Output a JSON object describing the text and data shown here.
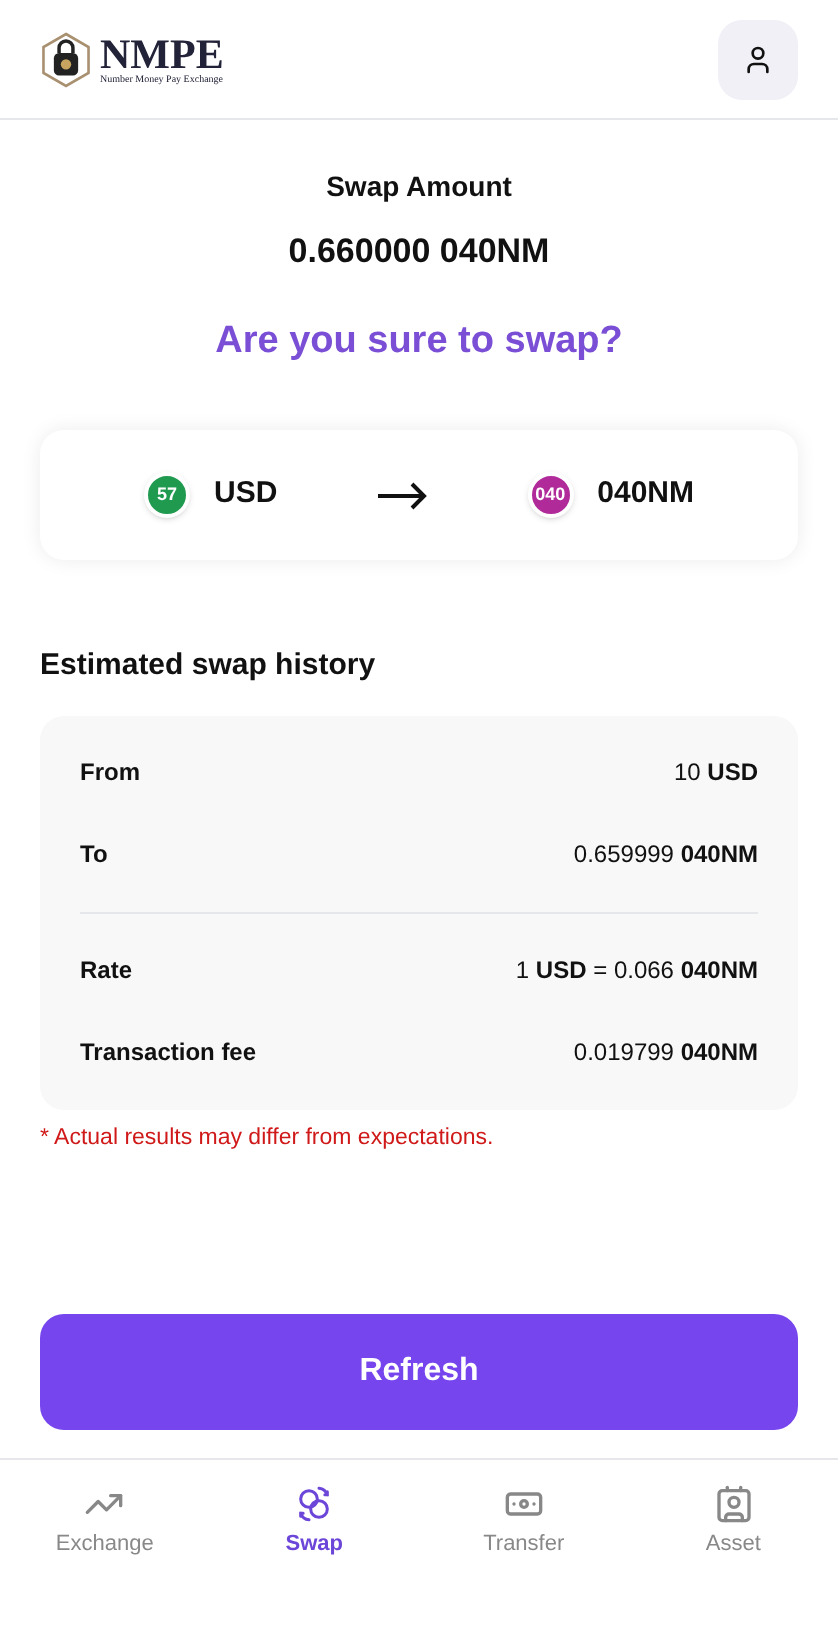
{
  "header": {
    "logo_title": "NMPE",
    "logo_subtitle": "Number Money Pay Exchange"
  },
  "summary": {
    "label": "Swap Amount",
    "amount": "0.660000 040NM",
    "question": "Are you sure to swap?"
  },
  "pair": {
    "from": {
      "badge": "57",
      "name": "USD",
      "color": "#1f9a4f"
    },
    "to": {
      "badge": "040",
      "name": "040NM",
      "color": "#b02a9a"
    }
  },
  "history": {
    "title": "Estimated swap history",
    "groups": [
      [
        {
          "label": "From",
          "value": "10 **USD**"
        },
        {
          "label": "To",
          "value": "0.659999 **040NM**"
        }
      ],
      [
        {
          "label": "Rate",
          "value": "1 **USD** = 0.066 **040NM**"
        },
        {
          "label": "Transaction fee",
          "value": "0.019799 **040NM**"
        }
      ]
    ],
    "note": "* Actual results may differ from expectations."
  },
  "refresh_button": "Refresh",
  "nav": [
    {
      "kind": "exchange",
      "label": "Exchange",
      "selected": false
    },
    {
      "kind": "swap",
      "label": "Swap",
      "selected": true
    },
    {
      "kind": "transfer",
      "label": "Transfer",
      "selected": false
    },
    {
      "kind": "asset",
      "label": "Asset",
      "selected": false
    }
  ]
}
